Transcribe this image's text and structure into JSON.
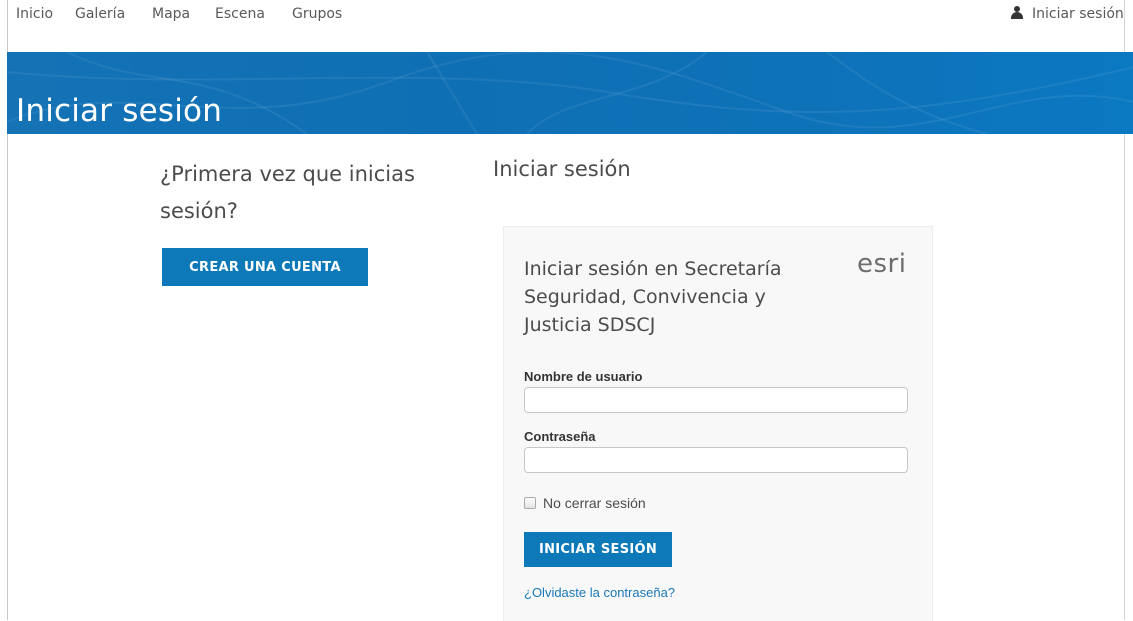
{
  "nav": {
    "items": [
      {
        "label": "Inicio"
      },
      {
        "label": "Galería"
      },
      {
        "label": "Mapa"
      },
      {
        "label": "Escena"
      },
      {
        "label": "Grupos"
      }
    ],
    "signin_label": "Iniciar sesión"
  },
  "banner": {
    "title": "Iniciar sesión",
    "color": "#0e72b8"
  },
  "left": {
    "heading": "¿Primera vez que inicias sesión?",
    "create_account_label": "CREAR UNA CUENTA"
  },
  "right": {
    "section_title": "Iniciar sesión",
    "panel": {
      "heading": "Iniciar sesión en Secretaría Seguridad, Convivencia y Justicia SDSCJ",
      "logo": "esri",
      "username_label": "Nombre de usuario",
      "username_value": "",
      "password_label": "Contraseña",
      "password_value": "",
      "remember_label": "No cerrar sesión",
      "remember_checked": false,
      "signin_button_label": "INICIAR SESIÓN",
      "forgot_label": "¿Olvidaste la contraseña?"
    }
  },
  "colors": {
    "accent": "#0d79b9",
    "link": "#1a78b8"
  },
  "icons": {
    "user": "user-icon"
  }
}
